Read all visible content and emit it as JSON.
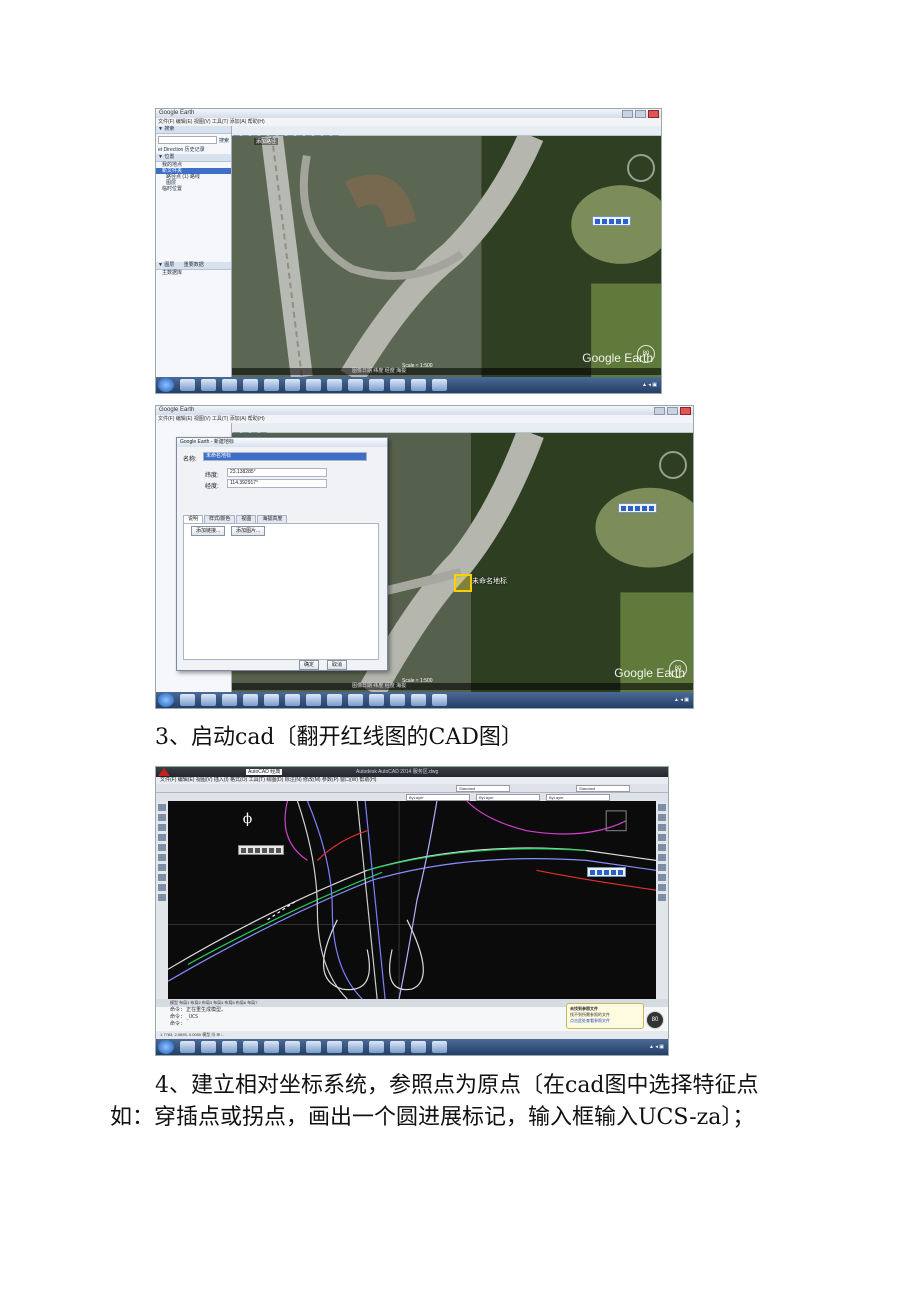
{
  "shot1": {
    "app_title": "Google Earth",
    "menu": "文件(F)  编辑(E)  视图(V)  工具(T)  添加(A)  帮助(H)",
    "sidebar": {
      "search_header": "▼ 搜索",
      "search_button": "搜索",
      "search_tabs": "et Direction  历史记录",
      "places_header": "▼ 位置",
      "tree": [
        "我的地点",
        "新文件夹",
        "路径点 (1) 路线",
        "图层",
        "临时位置"
      ],
      "layers_header": "▼ 图层",
      "layers_tab": "重要数据",
      "layers_item": "主数据库"
    },
    "map_button": "添加路径",
    "scale": "Scale ≈ 1:500",
    "status": "图像日期  纬度  经度  海拔",
    "logo": "Google Earth",
    "zoom": "80"
  },
  "shot2": {
    "app_title": "Google Earth",
    "menu": "文件(F)  编辑(E)  视图(V)  工具(T)  添加(A)  帮助(H)",
    "dialog": {
      "title": "Google Earth - 新建地标",
      "name_label": "名称:",
      "name_value": "未命名地标",
      "lat_label": "纬度:",
      "lat_value": "23.138285°",
      "lon_label": "经度:",
      "lon_value": "114.392917°",
      "tabs": [
        "说明",
        "样式/颜色",
        "视图",
        "海拔高度"
      ],
      "add_link": "添加链接...",
      "add_image": "添加图片...",
      "ok": "确定",
      "cancel": "取消"
    },
    "marker_label": "未命名地标",
    "scale": "Scale ≈ 1:500",
    "status": "图像日期  纬度  经度  海拔",
    "logo": "Google Earth",
    "zoom": "80"
  },
  "heading3": "3、启动cad〔翻开红线图的CAD图〕",
  "shot3": {
    "app_title": "Autodesk AutoCAD 2014    服务区.dwg",
    "workspace": "AutoCAD 经典",
    "menu": "文件(F)  编辑(E)  视图(V)  插入(I)  格式(O)  工具(T)  绘图(D)  标注(N)  修改(M)  参数(P)  窗口(W)  帮助(H)",
    "layer_select": "ByLayer",
    "style_select": "Standard",
    "layout_tabs": "模型  布局1  布局2  布局3  布局4  布局5  布局6  布局7",
    "cmd_lines": [
      "命令: 正在重生成模型。",
      "命令: _UCS",
      "命令:"
    ],
    "status": "1.7783, 2.0695, 0.0000    模型  ▦  ⊞  ∟",
    "balloon": {
      "title": "未找到参照文件",
      "body": "找不到所需参照的文件",
      "link": "点击此处查看参照文件"
    },
    "zoom": "80"
  },
  "heading4_line1": "4、建立相对坐标系统，参照点为原点〔在cad图中选择特征点",
  "heading4_line2": "如：穿插点或拐点，画出一个圆进展标记，输入框输入UCS-za〕；",
  "colors": {
    "accent": "#2b62c8",
    "marker": "#ffd000",
    "cad_bg": "#0b0b0b"
  }
}
